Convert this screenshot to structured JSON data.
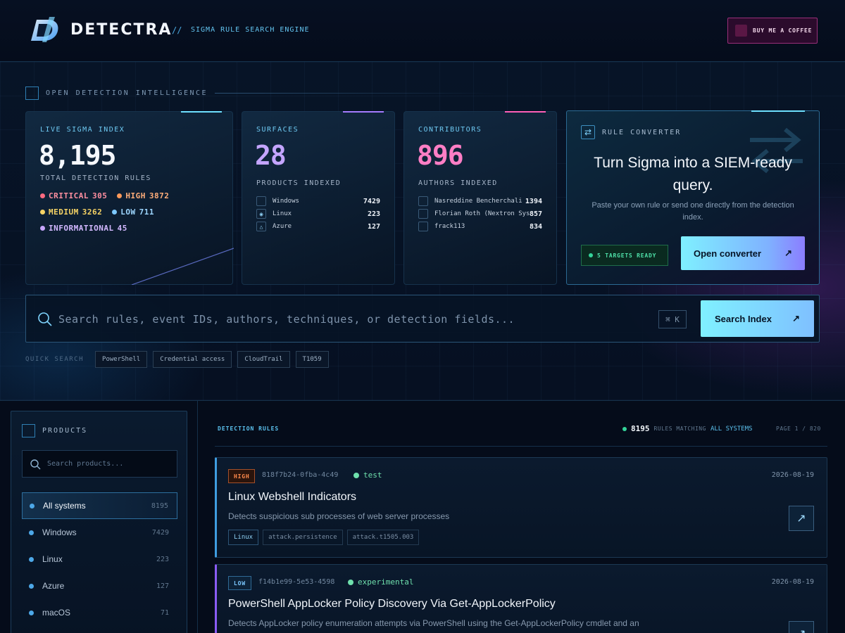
{
  "header": {
    "brand": "DETECTRA",
    "separator": "//",
    "tagline": "SIGMA RULE SEARCH ENGINE",
    "coffee_label": "BUY ME A COFFEE"
  },
  "hero": {
    "eyebrow": "OPEN DETECTION INTELLIGENCE",
    "index_card": {
      "label": "LIVE SIGMA INDEX",
      "value": "8,195",
      "sublabel": "TOTAL DETECTION RULES",
      "severities": [
        {
          "name": "CRITICAL",
          "count": "305",
          "color": "#ff6b81"
        },
        {
          "name": "HIGH",
          "count": "3872",
          "color": "#ff9a5a"
        },
        {
          "name": "MEDIUM",
          "count": "3262",
          "color": "#f6d365"
        },
        {
          "name": "LOW",
          "count": "711",
          "color": "#7cc8ff"
        },
        {
          "name": "INFORMATIONAL",
          "count": "45",
          "color": "#c7a6ff"
        }
      ]
    },
    "surfaces_card": {
      "label": "SURFACES",
      "value": "28",
      "sublabel": "PRODUCTS INDEXED",
      "items": [
        {
          "name": "Windows",
          "count": "7429",
          "icon": "windows-icon"
        },
        {
          "name": "Linux",
          "count": "223",
          "icon": "linux-icon"
        },
        {
          "name": "Azure",
          "count": "127",
          "icon": "azure-icon"
        }
      ]
    },
    "contributors_card": {
      "label": "CONTRIBUTORS",
      "value": "896",
      "sublabel": "AUTHORS INDEXED",
      "items": [
        {
          "name": "Nasreddine Bencherchali ...",
          "count": "1394"
        },
        {
          "name": "Florian Roth (Nextron Sys...",
          "count": "857"
        },
        {
          "name": "frack113",
          "count": "834"
        }
      ]
    },
    "converter": {
      "label": "RULE CONVERTER",
      "title": "Turn Sigma into a SIEM-ready query.",
      "description": "Paste your own rule or send one directly from the detection index.",
      "ready": "5 TARGETS READY",
      "button": "Open converter"
    },
    "search": {
      "placeholder": "Search rules, event IDs, authors, techniques, or detection fields...",
      "shortcut": "⌘ K",
      "button": "Search Index"
    },
    "quick_search": {
      "label": "QUICK SEARCH",
      "chips": [
        "PowerShell",
        "Credential access",
        "CloudTrail",
        "T1059"
      ]
    }
  },
  "sidebar": {
    "title": "PRODUCTS",
    "search_placeholder": "Search products...",
    "items": [
      {
        "name": "All systems",
        "count": "8195",
        "active": true
      },
      {
        "name": "Windows",
        "count": "7429"
      },
      {
        "name": "Linux",
        "count": "223"
      },
      {
        "name": "Azure",
        "count": "127"
      },
      {
        "name": "macOS",
        "count": "71"
      }
    ]
  },
  "results": {
    "heading": "DETECTION RULES",
    "match_count": "8195",
    "match_text": "RULES MATCHING",
    "match_scope": "ALL SYSTEMS",
    "page": "PAGE 1 / 820",
    "rules": [
      {
        "severity": "HIGH",
        "severity_color": "#ff8a4c",
        "id": "818f7b24-0fba-4c49",
        "status": "test",
        "date": "2026-08-19",
        "title": "Linux Webshell Indicators",
        "description": "Detects suspicious sub processes of web server processes",
        "tags": [
          "Linux",
          "attack.persistence",
          "attack.t1505.003"
        ]
      },
      {
        "severity": "LOW",
        "severity_color": "#7cc8ff",
        "id": "f14b1e99-5e53-4598",
        "status": "experimental",
        "date": "2026-08-19",
        "title": "PowerShell AppLocker Policy Discovery Via Get-AppLockerPolicy",
        "description": "Detects AppLocker policy enumeration attempts via PowerShell using the Get-AppLockerPolicy cmdlet and an",
        "tags": []
      }
    ]
  },
  "colors": {
    "accent_cyan": "#7ff0ff",
    "accent_pink": "#ff6bb5",
    "accent_purple": "#b08cff",
    "status_green": "#34d399"
  }
}
